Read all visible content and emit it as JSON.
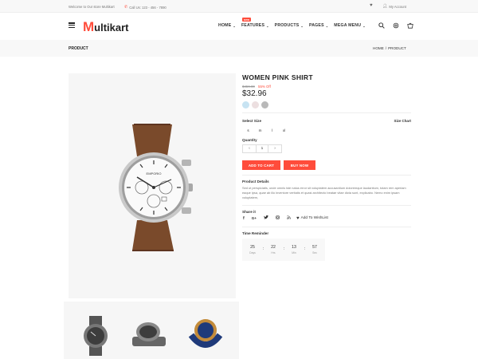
{
  "topbar": {
    "welcome": "Welcome to Our store Multikart",
    "call": "Call Us: 123 - 456 - 7890",
    "account": "My Account"
  },
  "logo": {
    "first": "M",
    "rest": "ultikart"
  },
  "nav": {
    "items": [
      "HOME",
      "FEATURES",
      "PRODUCTS",
      "PAGES",
      "MEGA MENU"
    ],
    "badge": "new"
  },
  "breadcrumb": {
    "title": "PRODUCT",
    "trail": [
      "HOME",
      "/",
      "PRODUCT"
    ]
  },
  "product": {
    "name": "WOMEN PINK SHIRT",
    "old_price": "$459.00",
    "discount": "55% Off",
    "price": "$32.96",
    "colors": [
      "#c7e3f2",
      "#ecdfe0",
      "#b9b9b9"
    ],
    "select_size_label": "Select Size",
    "size_chart_label": "Size Chart",
    "sizes": [
      "s",
      "m",
      "l",
      "xl"
    ],
    "quantity_label": "Quantity",
    "quantity": "1",
    "add_to_cart": "ADD TO CART",
    "buy_now": "BUY NOW",
    "details_label": "Product Details",
    "details_text": "Sed ut perspiciatis, unde omnis iste natus error sit voluptatem accusantium doloremque laudantium, totam rem aperiam eaque ipsa, quae ab illo inventore veritatis et quasi architecto beatae vitae dicta sunt, explicabo. Nemo enim ipsam voluptatem,",
    "share_label": "Share it",
    "share_icons": [
      "facebook-icon",
      "google-plus-icon",
      "twitter-icon",
      "instagram-icon",
      "rss-icon"
    ],
    "wishlist": "Add To WishList",
    "timer_label": "Time Reminder",
    "timer": [
      {
        "num": "25",
        "unit": "Days"
      },
      {
        "num": "22",
        "unit": "Hrs"
      },
      {
        "num": "13",
        "unit": "Min"
      },
      {
        "num": "57",
        "unit": "Sec"
      }
    ]
  },
  "colors": {
    "accent": "#ff4c3b"
  }
}
